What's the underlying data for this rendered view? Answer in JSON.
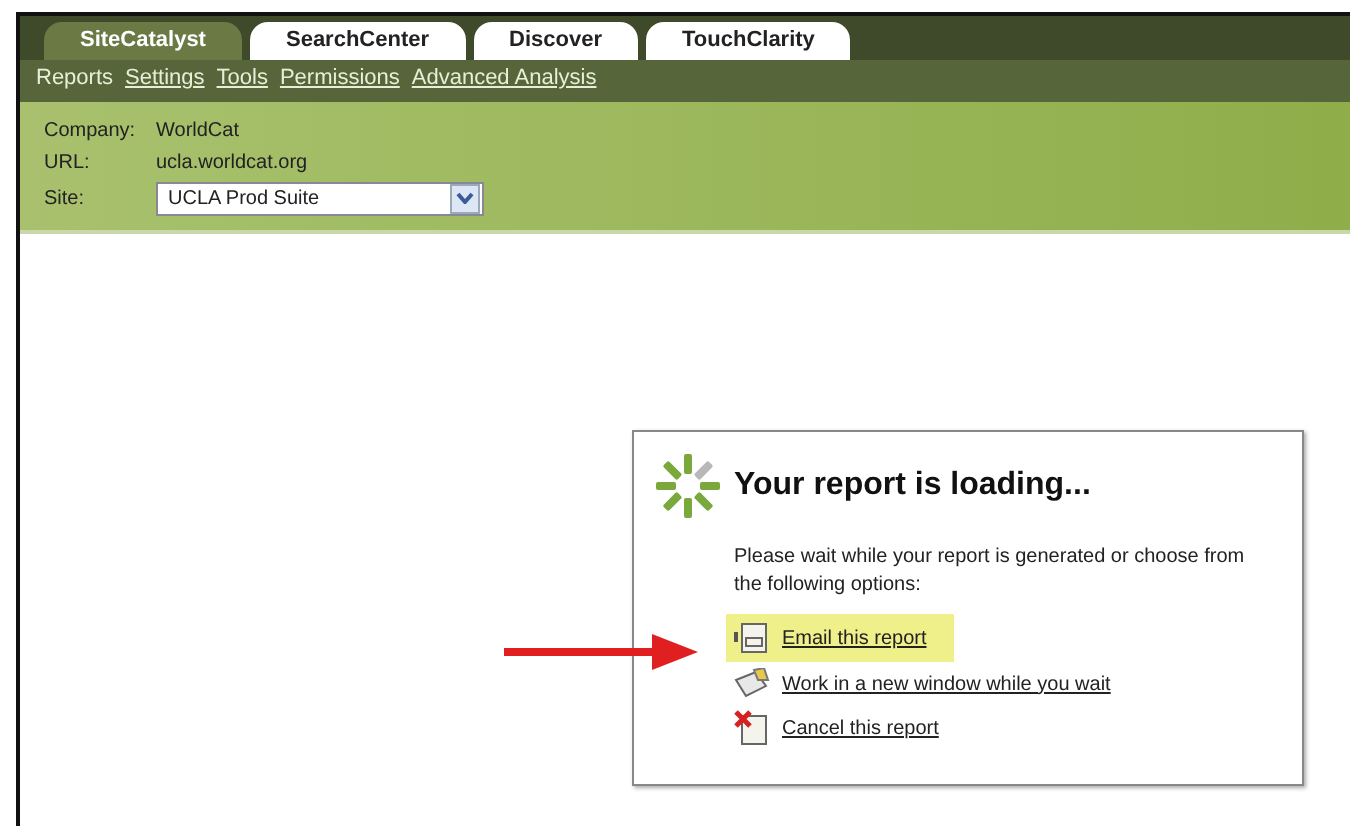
{
  "tabs": [
    {
      "label": "SiteCatalyst",
      "selected": true
    },
    {
      "label": "SearchCenter",
      "selected": false
    },
    {
      "label": "Discover",
      "selected": false
    },
    {
      "label": "TouchClarity",
      "selected": false
    }
  ],
  "nav": [
    {
      "label": "Reports",
      "selected": true
    },
    {
      "label": "Settings",
      "selected": false
    },
    {
      "label": "Tools",
      "selected": false
    },
    {
      "label": "Permissions",
      "selected": false
    },
    {
      "label": "Advanced Analysis",
      "selected": false
    }
  ],
  "info": [
    {
      "label": "Company:",
      "value": "WorldCat",
      "kind": "text"
    },
    {
      "label": "URL:",
      "value": "ucla.worldcat.org",
      "kind": "text"
    },
    {
      "label": "Site:",
      "value": "UCLA Prod Suite",
      "kind": "select"
    }
  ],
  "dialog": {
    "title": "Your report is loading...",
    "message": "Please wait while your report is generated or choose from the following options:",
    "options": [
      {
        "label": "Email this report",
        "kind": "email",
        "highlighted": true
      },
      {
        "label": "Work in a new window while you wait",
        "kind": "window",
        "highlighted": false
      },
      {
        "label": "Cancel this report",
        "kind": "cancel",
        "highlighted": false
      }
    ]
  },
  "annotation": {
    "kind": "arrow"
  }
}
